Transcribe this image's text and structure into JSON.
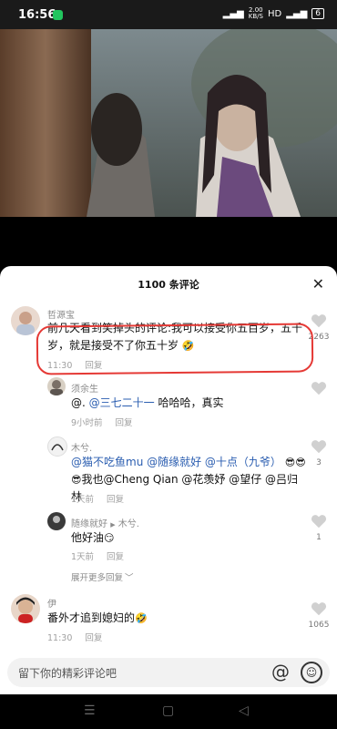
{
  "status": {
    "time": "16:56",
    "speed_top": "2.00",
    "speed_unit": "KB/S",
    "network": "HD",
    "battery": "6"
  },
  "sheet": {
    "title": "1100 条评论"
  },
  "comments": [
    {
      "user": "哲源宝",
      "text1": "前几天看到笑掉头的评论:我可以接受你五百岁，五千",
      "text2": "岁，就是接受不了你五十岁",
      "time": "11:30",
      "reply": "回复",
      "likes": "2263"
    },
    {
      "user": "须余生",
      "at": "@.",
      "mention": "@三七二十一",
      "rest": " 哈哈哈，真实",
      "time": "9小时前",
      "reply": "回复"
    },
    {
      "user": "木兮.",
      "line1": "@猫不吃鱼mu @随缘就好 @十点（九爷）",
      "line2": "我也@Cheng Qian @花羡妤 @望仔 @吕归林",
      "time": "1天前",
      "reply": "回复",
      "likes": "3"
    },
    {
      "user": "随缘就好",
      "arrow": "▶",
      "target": "木兮.",
      "text": "他好油",
      "time": "1天前",
      "reply": "回复",
      "likes": "1"
    },
    {
      "user": "伊",
      "text": "番外才追到媳妇的",
      "time": "11:30",
      "reply": "回复",
      "likes": "1065"
    }
  ],
  "expand": "展开更多回复",
  "input": {
    "placeholder": "留下你的精彩评论吧",
    "at": "@"
  },
  "nav": {
    "menu": "☰",
    "home": "▢",
    "back": "◁"
  },
  "icons": {
    "heart": "heart-icon",
    "close": "close-icon",
    "emoji": "emoji-icon"
  }
}
